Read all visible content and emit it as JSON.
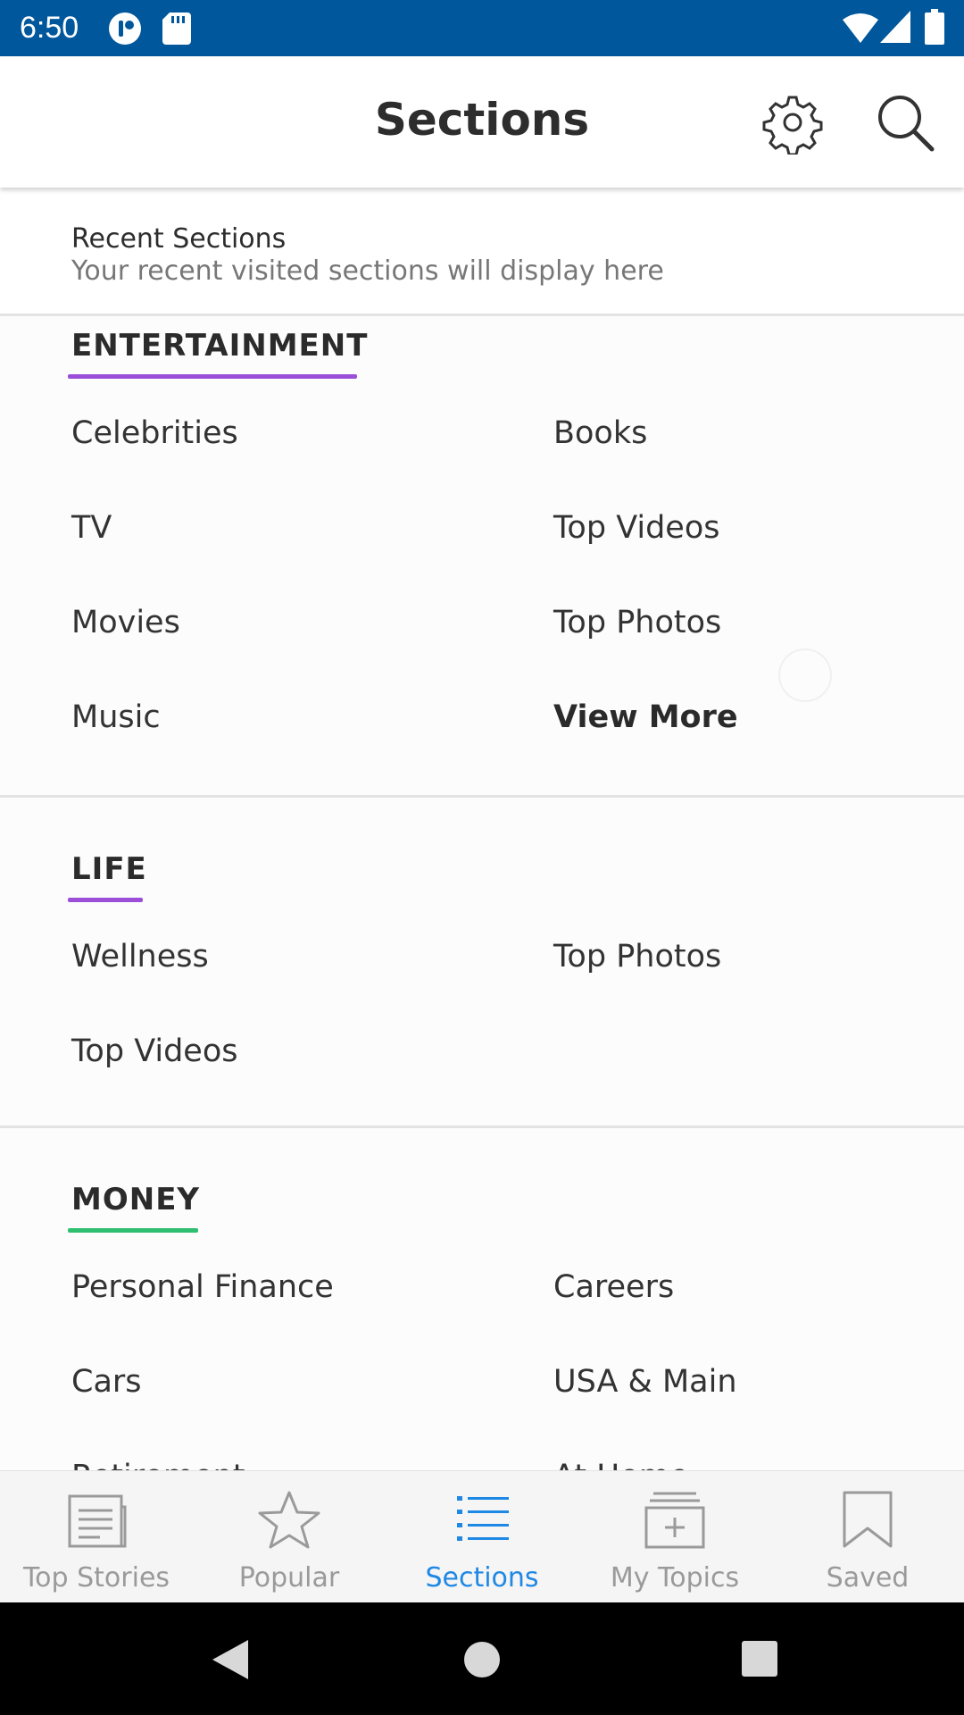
{
  "status_bar": {
    "time": "6:50",
    "icons": [
      "notification-app-icon",
      "sd-card-icon",
      "wifi-icon",
      "cell-signal-icon",
      "battery-icon"
    ]
  },
  "header": {
    "title": "Sections",
    "settings_icon": "gear-icon",
    "search_icon": "search-icon"
  },
  "recent": {
    "title": "Recent Sections",
    "subtitle": "Your recent visited sections will display here"
  },
  "sections": [
    {
      "title": "ENTERTAINMENT",
      "accent": "#9b4fd9",
      "items": [
        "Celebrities",
        "Books",
        "TV",
        "Top Videos",
        "Movies",
        "Top Photos",
        "Music",
        "View More"
      ]
    },
    {
      "title": "LIFE",
      "accent": "#9b4fd9",
      "items": [
        "Wellness",
        "Top Photos",
        "Top Videos"
      ]
    },
    {
      "title": "MONEY",
      "accent": "#2fbf71",
      "items": [
        "Personal Finance",
        "Careers",
        "Cars",
        "USA & Main",
        "Retirement",
        "At Home"
      ]
    }
  ],
  "bottom_nav": {
    "active": "Sections",
    "active_color": "#1e88e5",
    "items": [
      {
        "label": "Top Stories",
        "icon": "newspaper-icon"
      },
      {
        "label": "Popular",
        "icon": "star-icon"
      },
      {
        "label": "Sections",
        "icon": "list-icon"
      },
      {
        "label": "My Topics",
        "icon": "add-topic-icon"
      },
      {
        "label": "Saved",
        "icon": "bookmark-icon"
      }
    ]
  },
  "system_nav": [
    "back-icon",
    "home-icon",
    "recents-icon"
  ]
}
